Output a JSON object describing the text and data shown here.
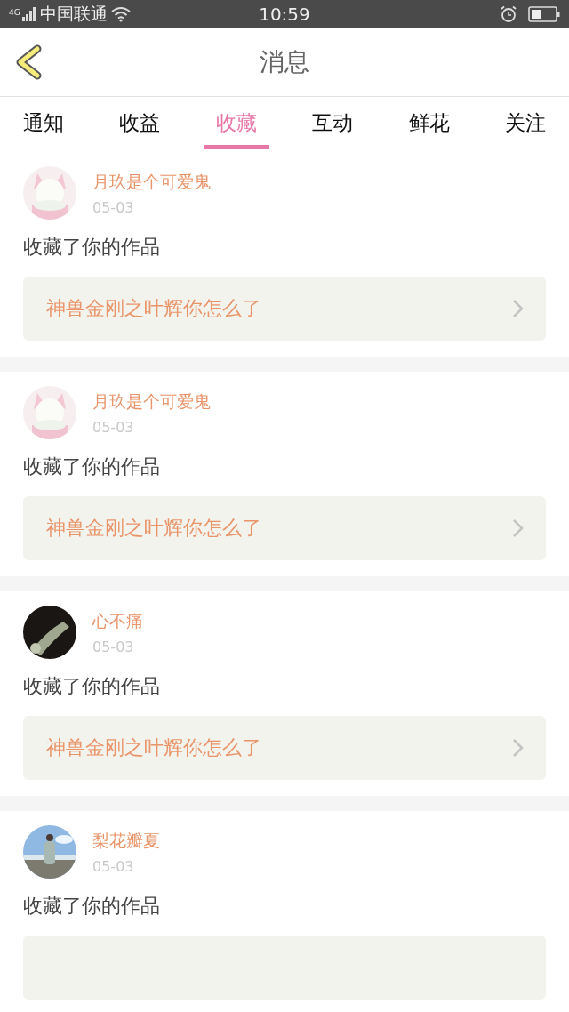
{
  "status_bar": {
    "network": "4G",
    "carrier": "中国联通",
    "time": "10:59"
  },
  "header": {
    "title": "消息"
  },
  "tabs": [
    {
      "label": "通知",
      "selected": false
    },
    {
      "label": "收益",
      "selected": false
    },
    {
      "label": "收藏",
      "selected": true
    },
    {
      "label": "互动",
      "selected": false
    },
    {
      "label": "鲜花",
      "selected": false
    },
    {
      "label": "关注",
      "selected": false
    }
  ],
  "messages": [
    {
      "user": "月玖是个可爱鬼",
      "date": "05-03",
      "action": "收藏了你的作品",
      "work": "神兽金刚之叶辉你怎么了"
    },
    {
      "user": "月玖是个可爱鬼",
      "date": "05-03",
      "action": "收藏了你的作品",
      "work": "神兽金刚之叶辉你怎么了"
    },
    {
      "user": "心不痛",
      "date": "05-03",
      "action": "收藏了你的作品",
      "work": "神兽金刚之叶辉你怎么了"
    },
    {
      "user": "梨花瓣夏",
      "date": "05-03",
      "action": "收藏了你的作品"
    }
  ]
}
